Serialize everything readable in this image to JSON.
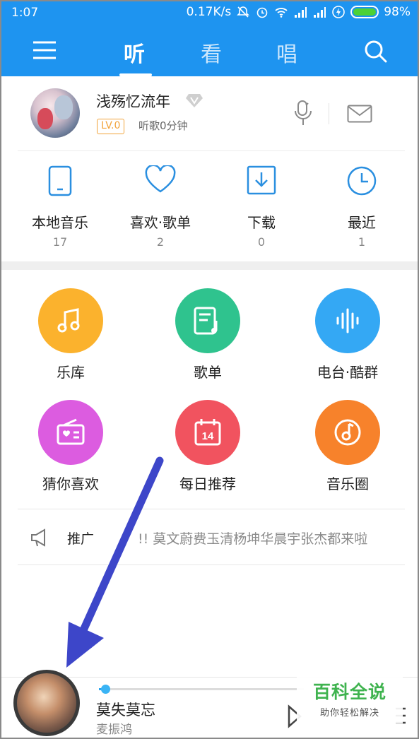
{
  "status_bar": {
    "time": "1:07",
    "network_speed": "0.17K/s",
    "battery_percent": "98%",
    "icons": [
      "mute-icon",
      "alarm-icon",
      "wifi-icon",
      "signal-icon",
      "signal-icon",
      "charging-icon",
      "battery-icon"
    ]
  },
  "header": {
    "tabs": [
      {
        "label": "听",
        "active": true
      },
      {
        "label": "看",
        "active": false
      },
      {
        "label": "唱",
        "active": false
      }
    ],
    "accent_color": "#1e94f0"
  },
  "profile": {
    "username": "浅殇忆流年",
    "level": "LV.0",
    "listen_time": "听歌0分钟"
  },
  "quick_access": [
    {
      "label": "本地音乐",
      "count": "17",
      "icon": "phone-icon"
    },
    {
      "label": "喜欢·歌单",
      "count": "2",
      "icon": "heart-icon"
    },
    {
      "label": "下载",
      "count": "0",
      "icon": "download-icon"
    },
    {
      "label": "最近",
      "count": "1",
      "icon": "clock-icon"
    }
  ],
  "grid": [
    {
      "label": "乐库",
      "icon": "music-note-icon",
      "color": "#fbb22d"
    },
    {
      "label": "歌单",
      "icon": "playlist-icon",
      "color": "#2fc38e"
    },
    {
      "label": "电台·酷群",
      "icon": "soundwave-icon",
      "color": "#34a8f4"
    },
    {
      "label": "猜你喜欢",
      "icon": "radio-heart-icon",
      "color": "#dc5ce0"
    },
    {
      "label": "每日推荐",
      "icon": "calendar-icon",
      "color": "#f1535f"
    },
    {
      "label": "音乐圈",
      "icon": "music-circle-icon",
      "color": "#f7822b"
    }
  ],
  "calendar_day": "14",
  "promo": {
    "label": "推广",
    "text": "!! 莫文蔚费玉清杨坤华晨宇张杰都来啦"
  },
  "player": {
    "song_title": "莫失莫忘",
    "artist": "麦振鸿",
    "progress": 0.03
  },
  "watermark": {
    "title": "百科全说",
    "subtitle": "助你轻松解决"
  }
}
